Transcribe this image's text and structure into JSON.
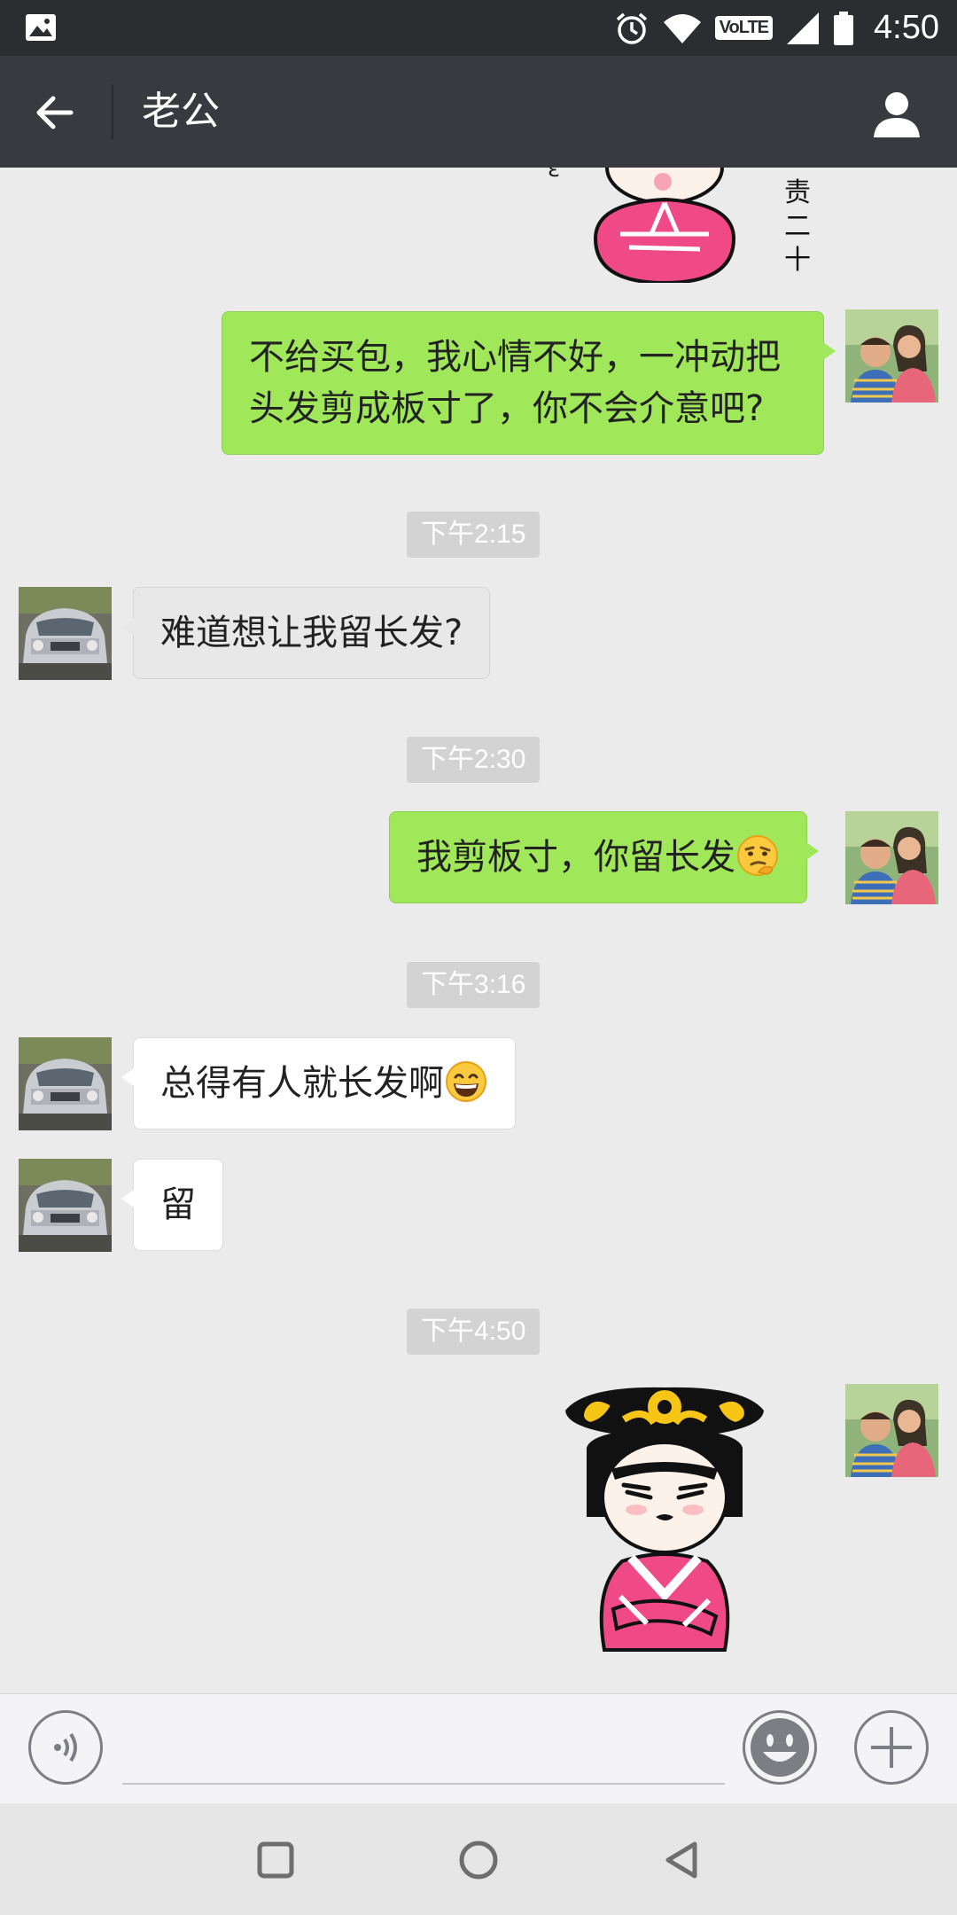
{
  "status_bar": {
    "network_badge": "VoLTE",
    "time": "4:50"
  },
  "header": {
    "title": "老公"
  },
  "messages": [
    {
      "side": "me",
      "text": "不给买包，我心情不好，一冲动把头发剪成板寸了，你不会介意吧?"
    },
    {
      "time": "下午2:15"
    },
    {
      "side": "them",
      "text": "难道想让我留长发?"
    },
    {
      "time": "下午2:30"
    },
    {
      "side": "me",
      "text": "我剪板寸，你留长发",
      "emoji": "thinking-face-emoji"
    },
    {
      "time": "下午3:16"
    },
    {
      "side": "them",
      "text": "总得有人就长发啊",
      "emoji": "grinning-face-emoji"
    },
    {
      "side": "them",
      "text": "留"
    },
    {
      "time": "下午4:50"
    },
    {
      "side": "me",
      "sticker": "empress-crossed-arms-sticker"
    }
  ],
  "top_sticker": {
    "caption_chars": "责二十"
  },
  "colors": {
    "status_bar_bg": "#2b2d30",
    "title_bar_bg": "#393a3f",
    "chat_bg": "#ebebeb",
    "my_bubble": "#a0e75a",
    "their_bubble": "#ffffff",
    "timestamp_chip": "#d3d3d3"
  }
}
